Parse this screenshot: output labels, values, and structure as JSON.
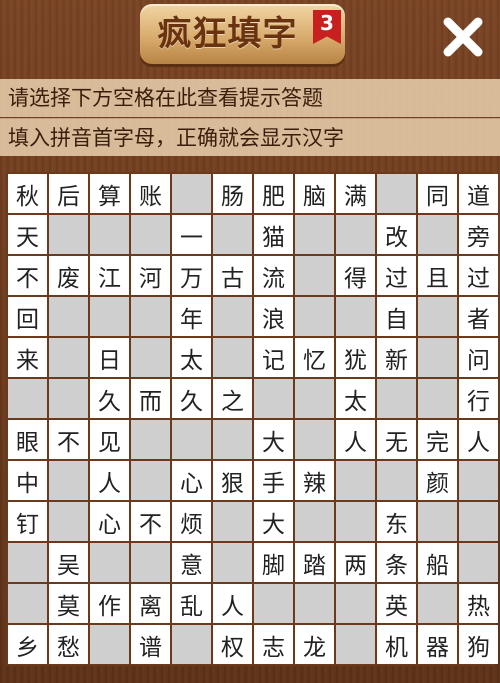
{
  "header": {
    "title": "疯狂填字",
    "level": "3"
  },
  "hints": {
    "line1": "请选择下方空格在此查看提示答题",
    "line2": "填入拼音首字母，正确就会显示汉字"
  },
  "grid": {
    "rows": [
      [
        "秋",
        "后",
        "算",
        "账",
        "_",
        "肠",
        "肥",
        "脑",
        "满",
        "_",
        "同",
        "道"
      ],
      [
        "天",
        "_",
        "_",
        "_",
        "一",
        "_",
        "猫",
        "_",
        "_",
        "改",
        "_",
        "旁"
      ],
      [
        "不",
        "废",
        "江",
        "河",
        "万",
        "古",
        "流",
        "_",
        "得",
        "过",
        "且",
        "过"
      ],
      [
        "回",
        "_",
        "_",
        "_",
        "年",
        "_",
        "浪",
        "_",
        "_",
        "自",
        "_",
        "者"
      ],
      [
        "来",
        "_",
        "日",
        "_",
        "太",
        "_",
        "记",
        "忆",
        "犹",
        "新",
        "_",
        "问"
      ],
      [
        "_",
        "_",
        "久",
        "而",
        "久",
        "之",
        "_",
        "_",
        "太",
        "_",
        "_",
        "行"
      ],
      [
        "眼",
        "不",
        "见",
        "_",
        "_",
        "_",
        "大",
        "_",
        "人",
        "无",
        "完",
        "人"
      ],
      [
        "中",
        "_",
        "人",
        "_",
        "心",
        "狠",
        "手",
        "辣",
        "_",
        "_",
        "颜",
        "_"
      ],
      [
        "钉",
        "_",
        "心",
        "不",
        "烦",
        "_",
        "大",
        "_",
        "_",
        "东",
        "_",
        "_"
      ],
      [
        "_",
        "吴",
        "_",
        "_",
        "意",
        "_",
        "脚",
        "踏",
        "两",
        "条",
        "船",
        "_"
      ],
      [
        "_",
        "莫",
        "作",
        "离",
        "乱",
        "人",
        "_",
        "_",
        "_",
        "英",
        "_",
        "热"
      ],
      [
        "乡",
        "愁",
        "_",
        "谱",
        "_",
        "权",
        "志",
        "龙",
        "_",
        "机",
        "器",
        "狗"
      ]
    ]
  }
}
